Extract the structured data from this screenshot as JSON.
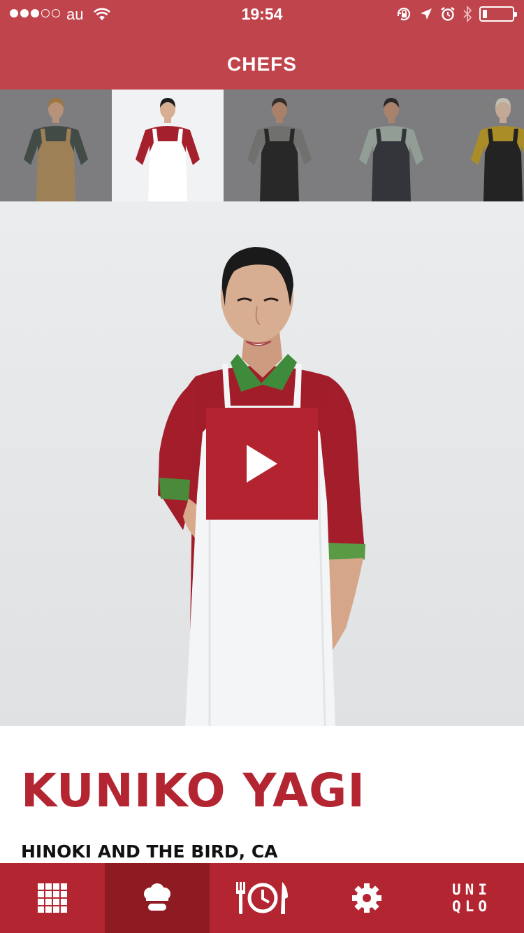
{
  "status_bar": {
    "carrier": "au",
    "time": "19:54",
    "signal_bars": 3,
    "battery_level": 0.15,
    "icons": [
      "signal-dots-icon",
      "wifi-icon",
      "rotation-lock-icon",
      "location-arrow-icon",
      "alarm-icon",
      "bluetooth-icon",
      "battery-icon"
    ]
  },
  "nav": {
    "title": "CHEFS"
  },
  "chefs": [
    {
      "apron_color": "#b8915a",
      "shirt_color": "#3f4a45",
      "skin": "#d9a98a",
      "hair": "#b9833e",
      "selected": false
    },
    {
      "apron_color": "#ffffff",
      "shirt_color": "#a3202c",
      "skin": "#d8ae92",
      "hair": "#1c1c1c",
      "selected": true
    },
    {
      "apron_color": "#1b1b1d",
      "shirt_color": "#7b7c7a",
      "skin": "#c99072",
      "hair": "#2a231e",
      "selected": false
    },
    {
      "apron_color": "#2a2c33",
      "shirt_color": "#a7b7ad",
      "skin": "#c69374",
      "hair": "#1f1c1a",
      "selected": false
    },
    {
      "apron_color": "#151515",
      "shirt_color": "#c9a21a",
      "skin": "#ebc6ae",
      "hair": "#e6e2d3",
      "selected": false
    }
  ],
  "featured": {
    "name": "KUNIKO YAGI",
    "restaurant": "HINOKI AND THE BIRD, CA",
    "play_icon": "play-icon"
  },
  "tab_bar": {
    "items": [
      {
        "name": "grid-icon",
        "selected": false
      },
      {
        "name": "chef-hat-icon",
        "selected": true
      },
      {
        "name": "fork-clock-plate-icon",
        "selected": false
      },
      {
        "name": "gear-icon",
        "selected": false
      },
      {
        "name": "uniqlo-logo"
      }
    ],
    "logo_line1": "UNI",
    "logo_line2": "QLO"
  },
  "colors": {
    "header": "#c0444c",
    "accent": "#b42532",
    "tab_selected": "#8e1b22"
  }
}
